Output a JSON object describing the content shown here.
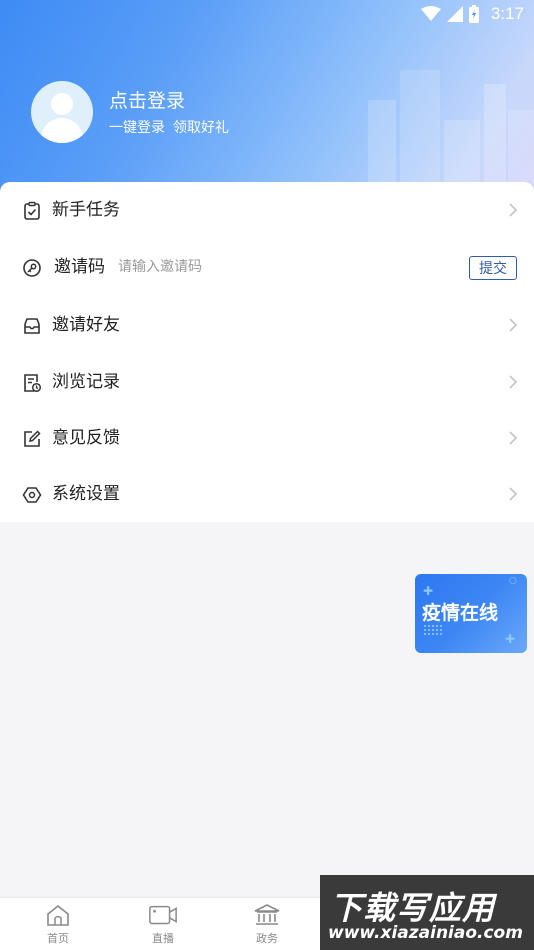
{
  "status": {
    "time": "3:17"
  },
  "profile": {
    "login_title": "点击登录",
    "login_sub_1": "一键登录",
    "login_sub_2": "领取好礼"
  },
  "menu": {
    "tasks_label": "新手任务",
    "invite_code_label": "邀请码",
    "invite_code_placeholder": "请输入邀请码",
    "invite_code_value": "",
    "submit_label": "提交",
    "invite_friends_label": "邀请好友",
    "history_label": "浏览记录",
    "feedback_label": "意见反馈",
    "settings_label": "系统设置"
  },
  "banner": {
    "text": "疫情在线"
  },
  "nav": {
    "items": [
      {
        "label": "首页",
        "icon": "home-icon"
      },
      {
        "label": "直播",
        "icon": "video-icon"
      },
      {
        "label": "政务",
        "icon": "government-icon"
      }
    ]
  },
  "watermark": {
    "title": "下载写应用",
    "url": "www.xiazainiao.com"
  },
  "colors": {
    "accent": "#2f5da6",
    "header_start": "#3d8bf5",
    "banner": "#2d78f0"
  }
}
